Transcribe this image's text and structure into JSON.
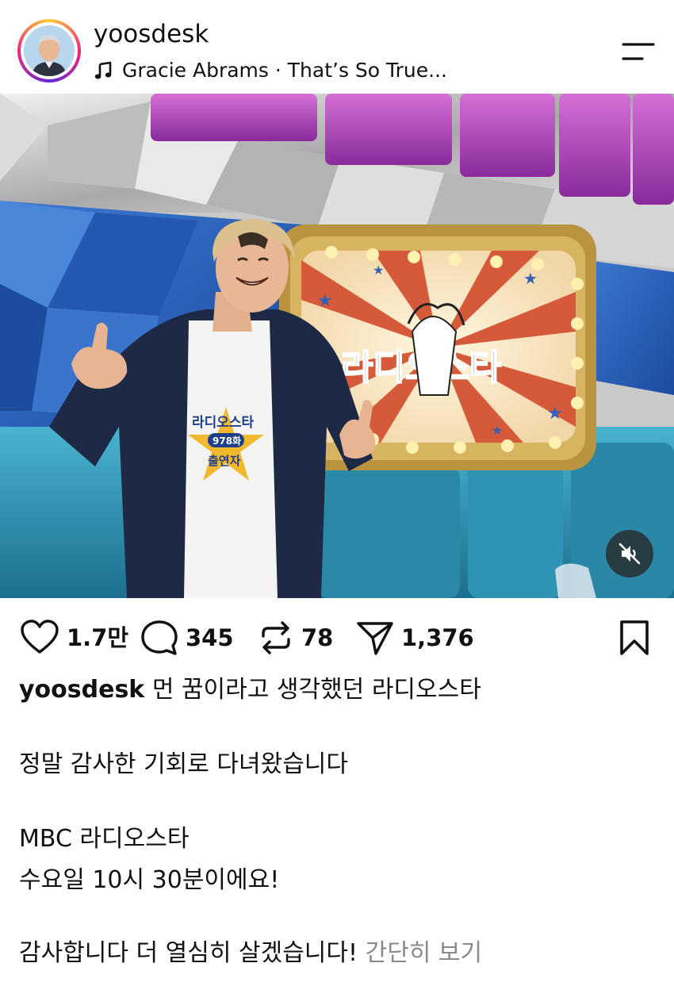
{
  "post": {
    "username": "yoosdesk",
    "music": "Gracie Abrams · That’s So True..."
  },
  "media": {
    "sign_text": "라디오스타",
    "shirt_line1": "라디오스타",
    "shirt_episode": "978화",
    "shirt_line2": "출연자"
  },
  "actions": {
    "likes": "1.7만",
    "comments": "345",
    "reposts": "78",
    "shares": "1,376"
  },
  "caption": {
    "username": "yoosdesk",
    "line1": "먼 꿈이라고 생각했던 라디오스타",
    "line2": "정말 감사한 기회로 다녀왔습니다",
    "line3": "MBC 라디오스타",
    "line4": "수요일 10시 30분이에요!",
    "line5": "감사합니다 더 열심히 살겠습니다!",
    "more": "간단히 보기"
  },
  "icons": {
    "music": "music-note-icon",
    "menu": "menu-icon",
    "like": "heart-icon",
    "comment": "comment-icon",
    "repost": "repost-icon",
    "share": "send-icon",
    "save": "bookmark-icon",
    "mute": "speaker-muted-icon"
  },
  "colors": {
    "avatar_ring": [
      "#f9ce34",
      "#ee2a7b",
      "#6228d7"
    ],
    "more_link": "#8a8a8a",
    "wall_purple": "#b43fc4",
    "wall_blue": "#2a5fb8",
    "bench_teal": "#2a8fae"
  }
}
